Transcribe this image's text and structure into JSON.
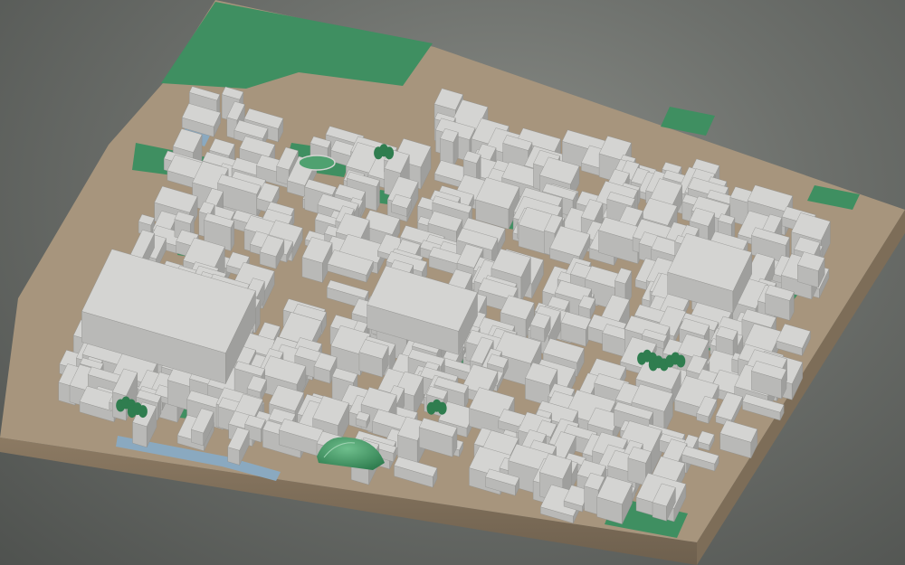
{
  "scene": {
    "kind": "3d-city-model",
    "ground_color": "#a7957d",
    "grass_color": "#3f8f61",
    "building_top_color": "#d4d4d2",
    "building_side_color": "#b9b9b7",
    "building_dark_color": "#9f9f9d",
    "water_color": "#8aa9c0",
    "tree_color": "#2f7d4f",
    "base_edge_color": "#8c7a63",
    "background_center": "#8a8d88",
    "background_edge": "#4f524f"
  }
}
